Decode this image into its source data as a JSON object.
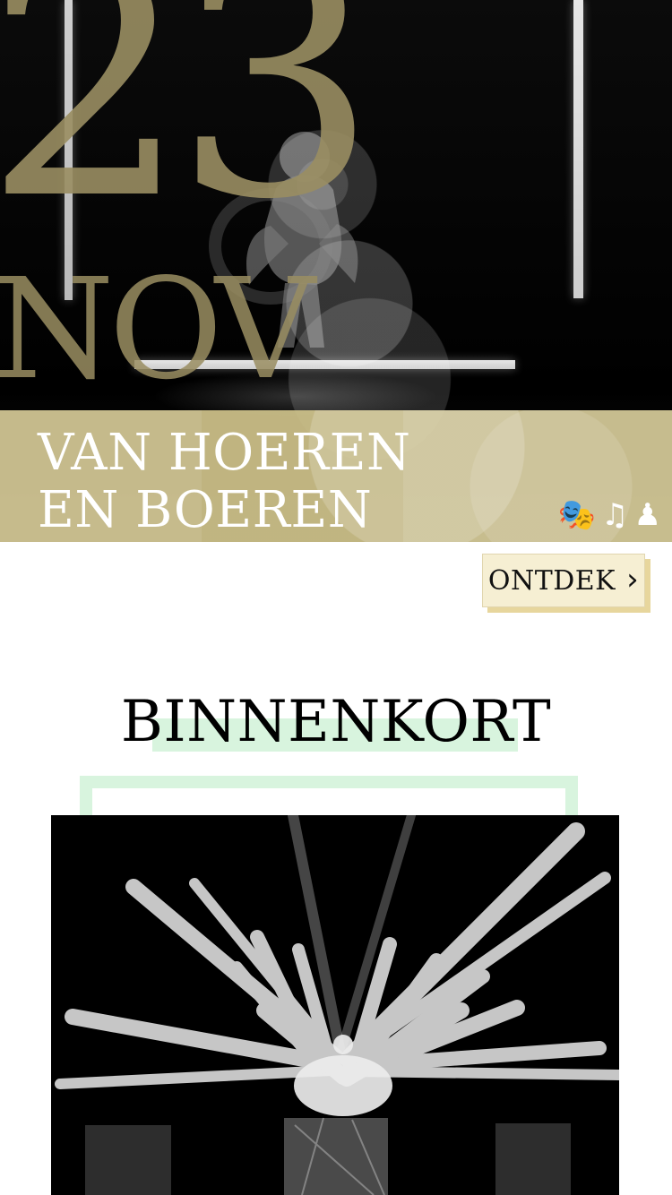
{
  "hero": {
    "day": "23",
    "month": "NOV",
    "title": "VAN HOEREN\nEN BOEREN",
    "genres": [
      {
        "name": "theatre-masks-icon",
        "glyph": "🎭"
      },
      {
        "name": "music-icon",
        "glyph": "♫"
      },
      {
        "name": "dance-icon",
        "glyph": "♟"
      }
    ],
    "cta_label": "ONTDEK"
  },
  "section": {
    "heading": "BINNENKORT"
  },
  "colors": {
    "gold": "#9a8e62",
    "band": "#cdc086",
    "button": "#f6efd3",
    "button_shadow": "#e7d69d",
    "mint": "#d8f4de"
  }
}
